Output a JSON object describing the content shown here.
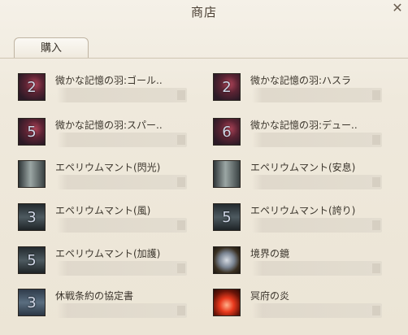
{
  "window": {
    "title": "商店",
    "close_glyph": "✕"
  },
  "tabs": [
    {
      "label": "購入",
      "active": true
    }
  ],
  "items": [
    {
      "name": "微かな記憶の羽:ゴール..",
      "count": "2",
      "icon": "feather-icon"
    },
    {
      "name": "微かな記憶の羽:ハスラ",
      "count": "2",
      "icon": "feather-icon"
    },
    {
      "name": "微かな記憶の羽:スパー..",
      "count": "5",
      "icon": "feather-icon"
    },
    {
      "name": "微かな記憶の羽:デュー..",
      "count": "6",
      "icon": "feather-icon"
    },
    {
      "name": "エペリウムマント(閃光)",
      "count": "",
      "icon": "cloak-icon"
    },
    {
      "name": "エペリウムマント(安息)",
      "count": "",
      "icon": "cloak-icon"
    },
    {
      "name": "エペリウムマント(風)",
      "count": "3",
      "icon": "cloak-icon"
    },
    {
      "name": "エペリウムマント(誇り)",
      "count": "5",
      "icon": "cloak-icon"
    },
    {
      "name": "エペリウムマント(加護)",
      "count": "5",
      "icon": "cloak-icon"
    },
    {
      "name": "境界の鏡",
      "count": "",
      "icon": "mirror-icon"
    },
    {
      "name": "休戦条約の協定書",
      "count": "3",
      "icon": "scroll-icon"
    },
    {
      "name": "冥府の炎",
      "count": "",
      "icon": "flame-icon"
    }
  ]
}
